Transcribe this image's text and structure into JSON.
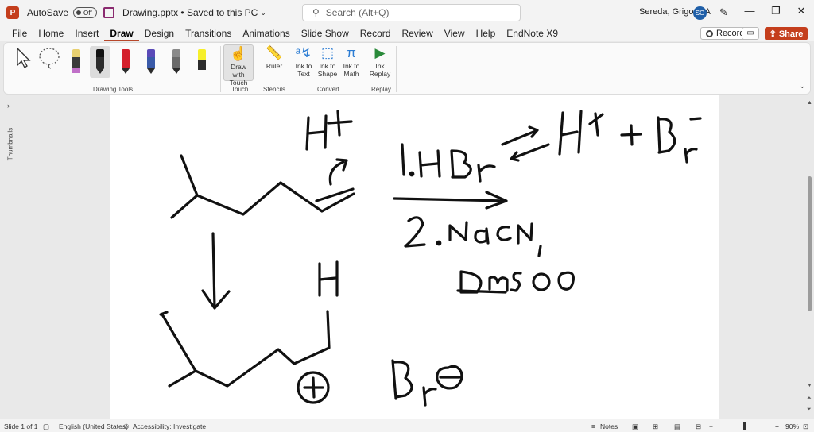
{
  "titlebar": {
    "app_icon": "P",
    "autosave_label": "AutoSave",
    "autosave_state": "Off",
    "filename": "Drawing.pptx • Saved to this PC",
    "search_placeholder": "Search (Alt+Q)",
    "user_name": "Sereda, Grigoriy A",
    "user_initials": "SG",
    "window_controls": [
      "—",
      "❐",
      "✕"
    ]
  },
  "tabs": [
    "File",
    "Home",
    "Insert",
    "Draw",
    "Design",
    "Transitions",
    "Animations",
    "Slide Show",
    "Record",
    "Review",
    "View",
    "Help",
    "EndNote X9"
  ],
  "active_tab": "Draw",
  "ribbon_right": {
    "record_label": "Record",
    "share_label": "Share"
  },
  "ribbon": {
    "drawing_tools_label": "Drawing Tools",
    "pen_colors": [
      "#e8d070",
      "#111111",
      "#d4202c",
      "#5a4ab8",
      "#8a8a8a",
      "#f6ef2a"
    ],
    "touch_group_label": "Touch",
    "draw_with_touch": "Draw with Touch",
    "stencils_label": "Stencils",
    "ruler": "Ruler",
    "convert_label": "Convert",
    "ink_to_text": "Ink to Text",
    "ink_to_shape": "Ink to Shape",
    "ink_to_math": "Ink to Math",
    "replay_label": "Replay",
    "ink_replay": "Ink Replay"
  },
  "thumbnails_label": "Thumbnails",
  "statusbar": {
    "slide": "Slide 1 of 1",
    "language": "English (United States)",
    "accessibility": "Accessibility: Investigate",
    "notes": "Notes",
    "zoom": "90%"
  }
}
